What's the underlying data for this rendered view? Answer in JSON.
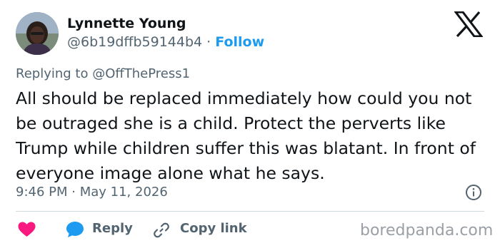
{
  "author": {
    "name": "Lynnette Young",
    "handle": "@6b19dffb59144b4",
    "separator": " · ",
    "follow_label": "Follow"
  },
  "reply_context": {
    "prefix": "Replying to ",
    "mention": "@OffThePress1"
  },
  "tweet": {
    "text": "All should be replaced immediately how could you not be outraged she is a child. Protect the perverts like Trump while children suffer this was blatant. In front of everyone image alone what he says.",
    "time": "9:46 PM",
    "date_separator": " · ",
    "date": "May 11, 2026"
  },
  "actions": {
    "reply_label": "Reply",
    "copy_link_label": "Copy link"
  },
  "watermark": "boredpanda.com",
  "icons": {
    "logo": "x-logo-icon",
    "info": "info-icon",
    "like": "heart-icon",
    "reply": "reply-bubble-icon",
    "copy": "link-icon"
  },
  "colors": {
    "accent": "#1d9bf0",
    "heart": "#f91880",
    "muted": "#536471",
    "text": "#0f1419"
  }
}
